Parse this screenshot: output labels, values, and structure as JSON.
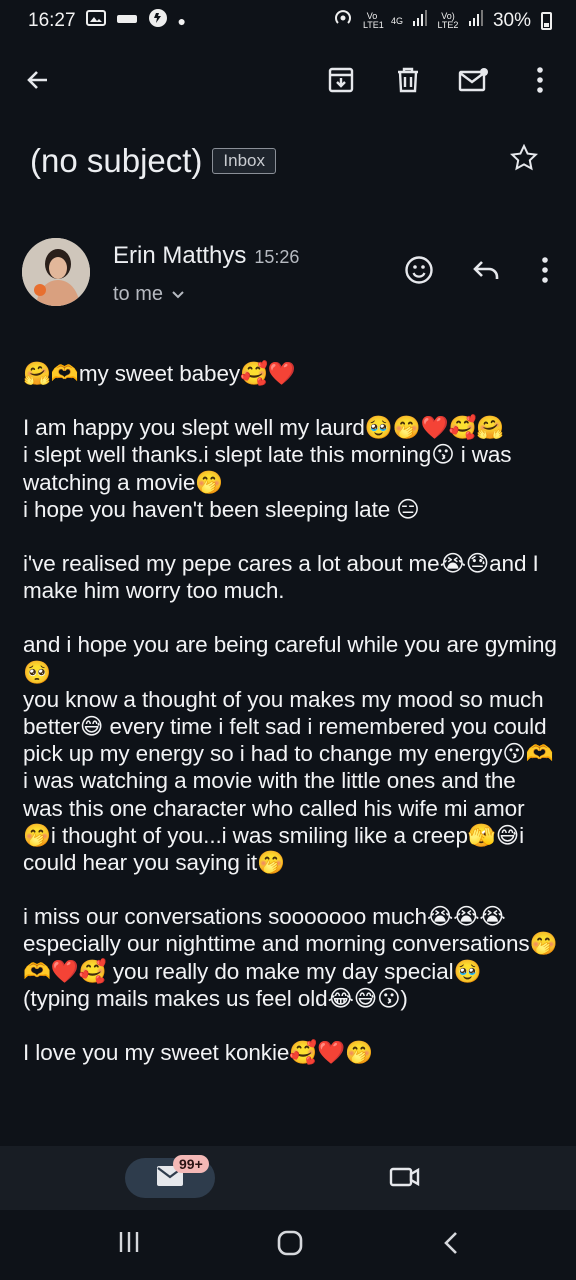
{
  "status_bar": {
    "time": "16:27",
    "net_labels": [
      "Vo LTE1",
      "4G",
      "Vo) LTE2"
    ],
    "battery": "30%"
  },
  "toolbar": {
    "icons": [
      "back-arrow-icon",
      "archive-icon",
      "delete-icon",
      "mark-unread-icon",
      "more-vert-icon"
    ]
  },
  "email": {
    "subject": "(no subject)",
    "label": "Inbox",
    "sender_name": "Erin Matthys",
    "time": "15:26",
    "recipient": "to me",
    "body": [
      "🤗🫶my sweet babey🥰❤️",
      "I am happy you slept well my laurd🥹🤭❤️🥰🤗\ni slept well thanks.i slept late this morning😗 i was watching a movie🤭\ni hope you haven't been sleeping late 😑",
      "i've realised my pepe cares a lot about me😭😓and I make him worry too much.",
      "and i hope you are being careful while you are gyming 🥺\nyou know a thought of you makes my mood so much better😅 every time i felt sad i remembered you could pick up my energy so i had to change my energy😗🫶\ni was watching a movie with the little ones and the was this one character who called his wife mi amor 🤭i thought of you...i was smiling like a creep🫣😅i could hear you saying it🤭",
      "i miss our conversations sooooooo much😭😭😭\nespecially our nighttime and morning conversations🤭🫶❤️🥰 you really do make my day special🥹\n(typing mails makes us feel old😂😅😗)",
      "\nI love you my sweet konkie🥰❤️🤭"
    ]
  },
  "bottom_nav": {
    "unread_count": "99+"
  },
  "colors": {
    "background": "#0e1218",
    "nav_background": "#181d24",
    "pill": "#2e3c4c",
    "badge": "#f3b8b6"
  }
}
